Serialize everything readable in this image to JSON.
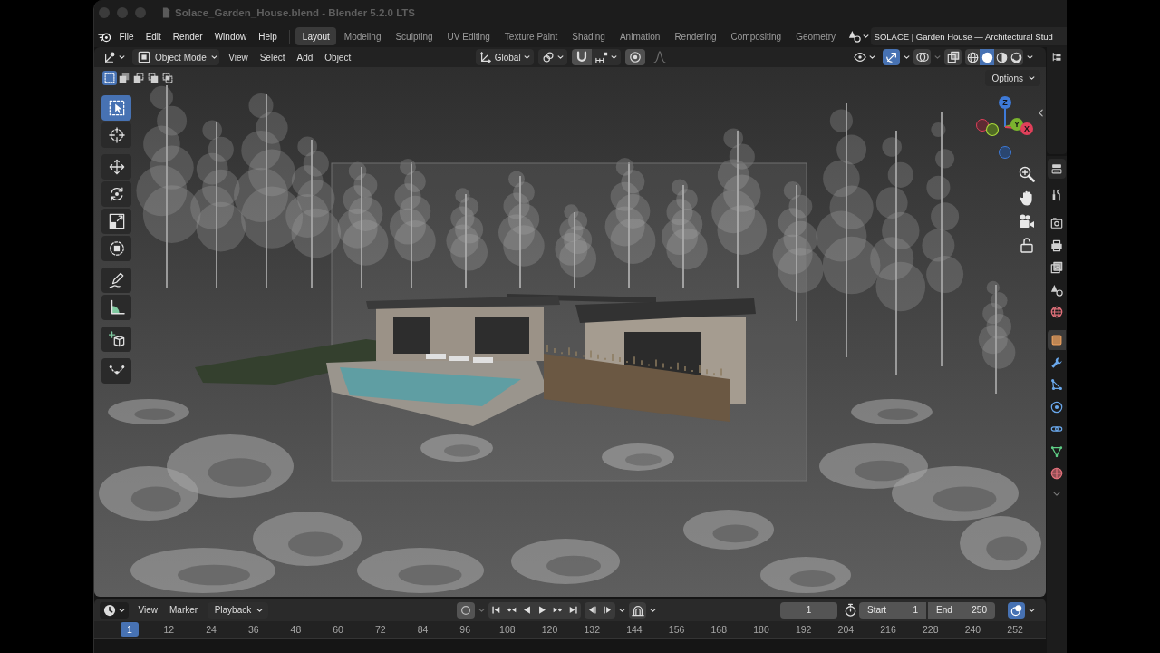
{
  "window": {
    "title": "Solace_Garden_House.blend - Blender 5.2.0 LTS"
  },
  "menu_bar": {
    "menus": [
      "File",
      "Edit",
      "Render",
      "Window",
      "Help"
    ],
    "workspaces": [
      {
        "label": "Layout",
        "selected": true
      },
      {
        "label": "Modeling",
        "selected": false
      },
      {
        "label": "Sculpting",
        "selected": false
      },
      {
        "label": "UV Editing",
        "selected": false
      },
      {
        "label": "Texture Paint",
        "selected": false
      },
      {
        "label": "Shading",
        "selected": false
      },
      {
        "label": "Animation",
        "selected": false
      },
      {
        "label": "Rendering",
        "selected": false
      },
      {
        "label": "Compositing",
        "selected": false
      },
      {
        "label": "Geometry",
        "selected": false
      }
    ],
    "scene": "SOLACE | Garden House — Architectural Stud"
  },
  "viewport_header": {
    "mode": "Object Mode",
    "menus": [
      "View",
      "Select",
      "Add",
      "Object"
    ],
    "orientation": "Global",
    "toggles": [
      {
        "kind": "gizmo",
        "on": true
      },
      {
        "kind": "overlays",
        "on": false
      },
      {
        "kind": "xray",
        "on": false
      }
    ],
    "shading": [
      {
        "kind": "wireframe",
        "selected": false
      },
      {
        "kind": "solid",
        "selected": true
      },
      {
        "kind": "material",
        "selected": false
      },
      {
        "kind": "rendered",
        "selected": false
      }
    ]
  },
  "viewport": {
    "select_modes": [
      {
        "kind": "new",
        "selected": true
      },
      {
        "kind": "extend",
        "selected": false
      },
      {
        "kind": "subtract",
        "selected": false
      },
      {
        "kind": "invert",
        "selected": false
      },
      {
        "kind": "intersect",
        "selected": false
      }
    ],
    "tool_groups": [
      {
        "tools": [
          {
            "kind": "select_box",
            "selected": true
          },
          {
            "kind": "cursor",
            "selected": false
          }
        ]
      },
      {
        "tools": [
          {
            "kind": "move",
            "selected": false
          },
          {
            "kind": "rotate",
            "selected": false
          },
          {
            "kind": "scale",
            "selected": false
          },
          {
            "kind": "transform",
            "selected": false
          }
        ]
      },
      {
        "tools": [
          {
            "kind": "annotate",
            "selected": false
          },
          {
            "kind": "measure",
            "selected": false
          }
        ]
      },
      {
        "tools": [
          {
            "kind": "add_cube",
            "selected": false
          }
        ]
      },
      {
        "tools": [
          {
            "kind": "curve",
            "selected": false
          }
        ]
      }
    ],
    "options": "Options",
    "axes": [
      "Z",
      "Y",
      "X"
    ]
  },
  "property_tabs": [
    {
      "tabs": [
        {
          "kind": "tool",
          "selected": false
        }
      ]
    },
    {
      "tabs": [
        {
          "kind": "render",
          "selected": false
        },
        {
          "kind": "output",
          "selected": false
        },
        {
          "kind": "view_layer",
          "selected": false
        },
        {
          "kind": "scene",
          "selected": false
        },
        {
          "kind": "world",
          "selected": false
        }
      ]
    },
    {
      "tabs": [
        {
          "kind": "object",
          "selected": true
        },
        {
          "kind": "modifiers",
          "selected": false
        },
        {
          "kind": "particles",
          "selected": false
        },
        {
          "kind": "physics",
          "selected": false
        },
        {
          "kind": "constraints",
          "selected": false
        },
        {
          "kind": "data",
          "selected": false
        },
        {
          "kind": "material",
          "selected": false
        }
      ]
    }
  ],
  "timeline": {
    "menus": [
      "View",
      "Marker"
    ],
    "playback": "Playback",
    "auto_keying": false,
    "current_frame": "1",
    "start": {
      "label": "Start",
      "value": "1"
    },
    "end": {
      "label": "End",
      "value": "250"
    },
    "right_toggle": {
      "on": true
    },
    "ruler": [
      {
        "label": "1",
        "current": true
      },
      {
        "label": "12",
        "current": false
      },
      {
        "label": "24",
        "current": false
      },
      {
        "label": "36",
        "current": false
      },
      {
        "label": "48",
        "current": false
      },
      {
        "label": "60",
        "current": false
      },
      {
        "label": "72",
        "current": false
      },
      {
        "label": "84",
        "current": false
      },
      {
        "label": "96",
        "current": false
      },
      {
        "label": "108",
        "current": false
      },
      {
        "label": "120",
        "current": false
      },
      {
        "label": "132",
        "current": false
      },
      {
        "label": "144",
        "current": false
      },
      {
        "label": "156",
        "current": false
      },
      {
        "label": "168",
        "current": false
      },
      {
        "label": "180",
        "current": false
      },
      {
        "label": "192",
        "current": false
      },
      {
        "label": "204",
        "current": false
      },
      {
        "label": "216",
        "current": false
      },
      {
        "label": "228",
        "current": false
      },
      {
        "label": "240",
        "current": false
      },
      {
        "label": "252",
        "current": false
      }
    ]
  }
}
